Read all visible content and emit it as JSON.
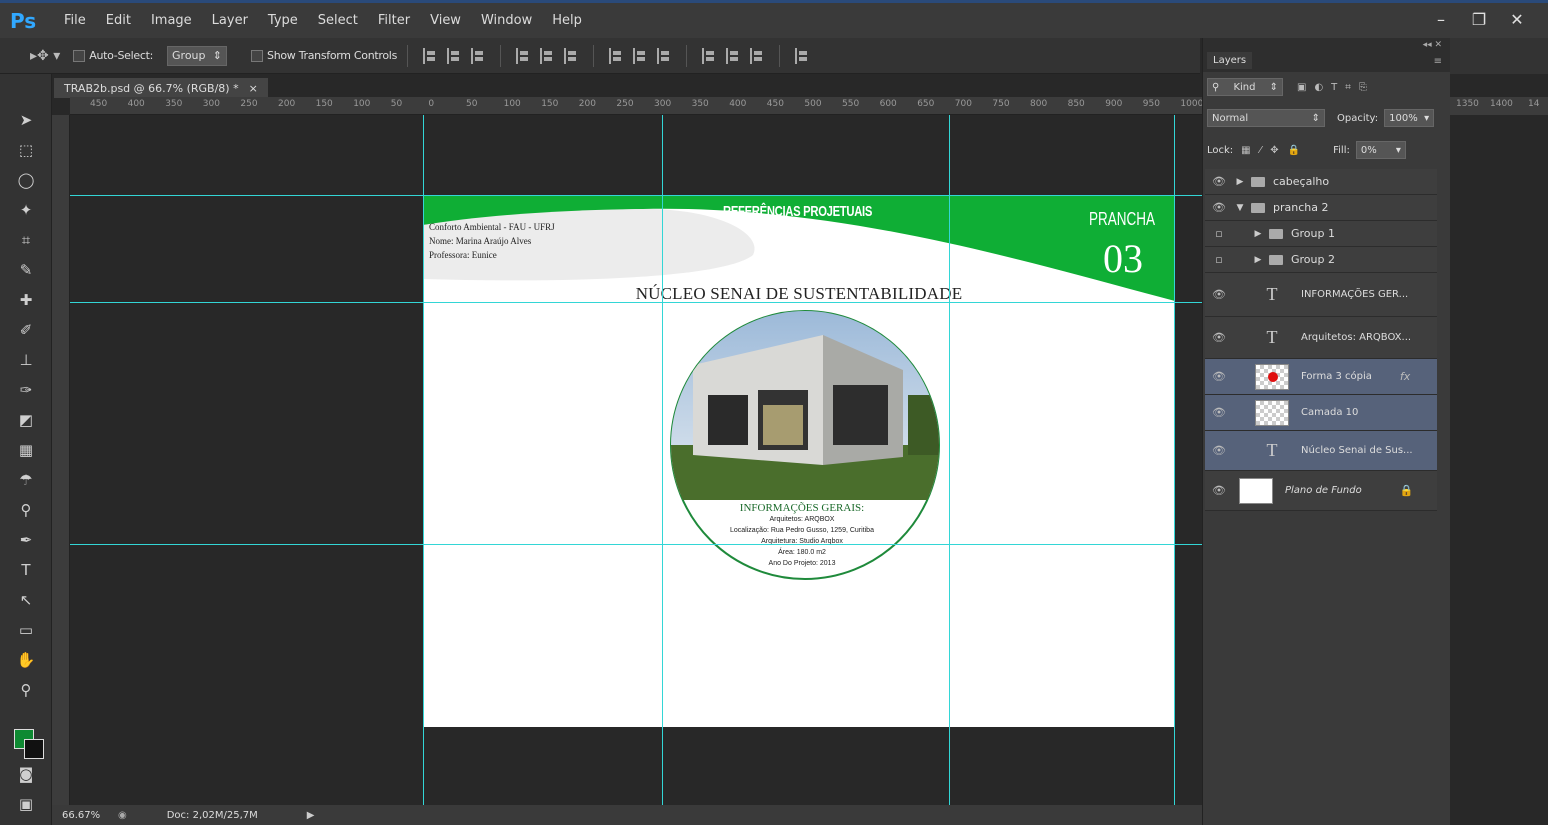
{
  "app": {
    "logo": "Ps"
  },
  "menu": [
    "File",
    "Edit",
    "Image",
    "Layer",
    "Type",
    "Select",
    "Filter",
    "View",
    "Window",
    "Help"
  ],
  "window_controls": {
    "minimize": "–",
    "restore": "❐",
    "close": "✕"
  },
  "options_bar": {
    "auto_select_label": "Auto-Select:",
    "auto_select_value": "Group",
    "show_transform_label": "Show Transform Controls"
  },
  "document": {
    "tab_title": "TRAB2b.psd @ 66.7% (RGB/8) *",
    "tab_close": "×",
    "header_title": "REFERÊNCIAS PROJETUAIS",
    "prancha_label": "PRANCHA",
    "prancha_number": "03",
    "credits": [
      "Conforto Ambiental - FAU - UFRJ",
      "Nome: Marina Araújo Alves",
      "Professora: Eunice"
    ],
    "heading": "NÚCLEO SENAI DE SUSTENTABILIDADE",
    "info_title": "INFORMAÇÕES GERAIS:",
    "info_lines": [
      "Arquitetos: ARQBOX",
      "Localização: Rua Pedro Gusso, 1259, Curitiba",
      "Arquitetura: Studio Arqbox",
      "Área: 180.0 m2",
      "Ano Do Projeto: 2013"
    ]
  },
  "ruler_ticks": [
    "450",
    "400",
    "350",
    "300",
    "250",
    "200",
    "150",
    "100",
    "50",
    "0",
    "50",
    "100",
    "150",
    "200",
    "250",
    "300",
    "350",
    "400",
    "450",
    "500",
    "550",
    "600",
    "650",
    "700",
    "750",
    "800",
    "850",
    "900",
    "950",
    "1000"
  ],
  "ruler_ticks_right": [
    "1350",
    "1400",
    "14"
  ],
  "status": {
    "zoom": "66.67%",
    "doc": "Doc: 2,02M/25,7M"
  },
  "layers_panel": {
    "tab": "Layers",
    "kind_label": "Kind",
    "blend_mode": "Normal",
    "opacity_label": "Opacity:",
    "opacity_value": "100%",
    "lock_label": "Lock:",
    "fill_label": "Fill:",
    "fill_value": "0%",
    "layers": [
      {
        "name": "cabeçalho"
      },
      {
        "name": "prancha 2"
      },
      {
        "name": "Group 1"
      },
      {
        "name": "Group 2"
      },
      {
        "name": "INFORMAÇÕES GER..."
      },
      {
        "name": "Arquitetos: ARQBOX..."
      },
      {
        "name": "Forma 3 cópia",
        "fx": "fx"
      },
      {
        "name": "Camada 10"
      },
      {
        "name": "Núcleo Senai de Sus..."
      },
      {
        "name": "Plano de Fundo"
      }
    ]
  },
  "colors": {
    "accent_green": "#0fae35",
    "foreground": "#0e8a32",
    "guide": "#33d6d6",
    "ps_blue": "#31a8ff"
  }
}
